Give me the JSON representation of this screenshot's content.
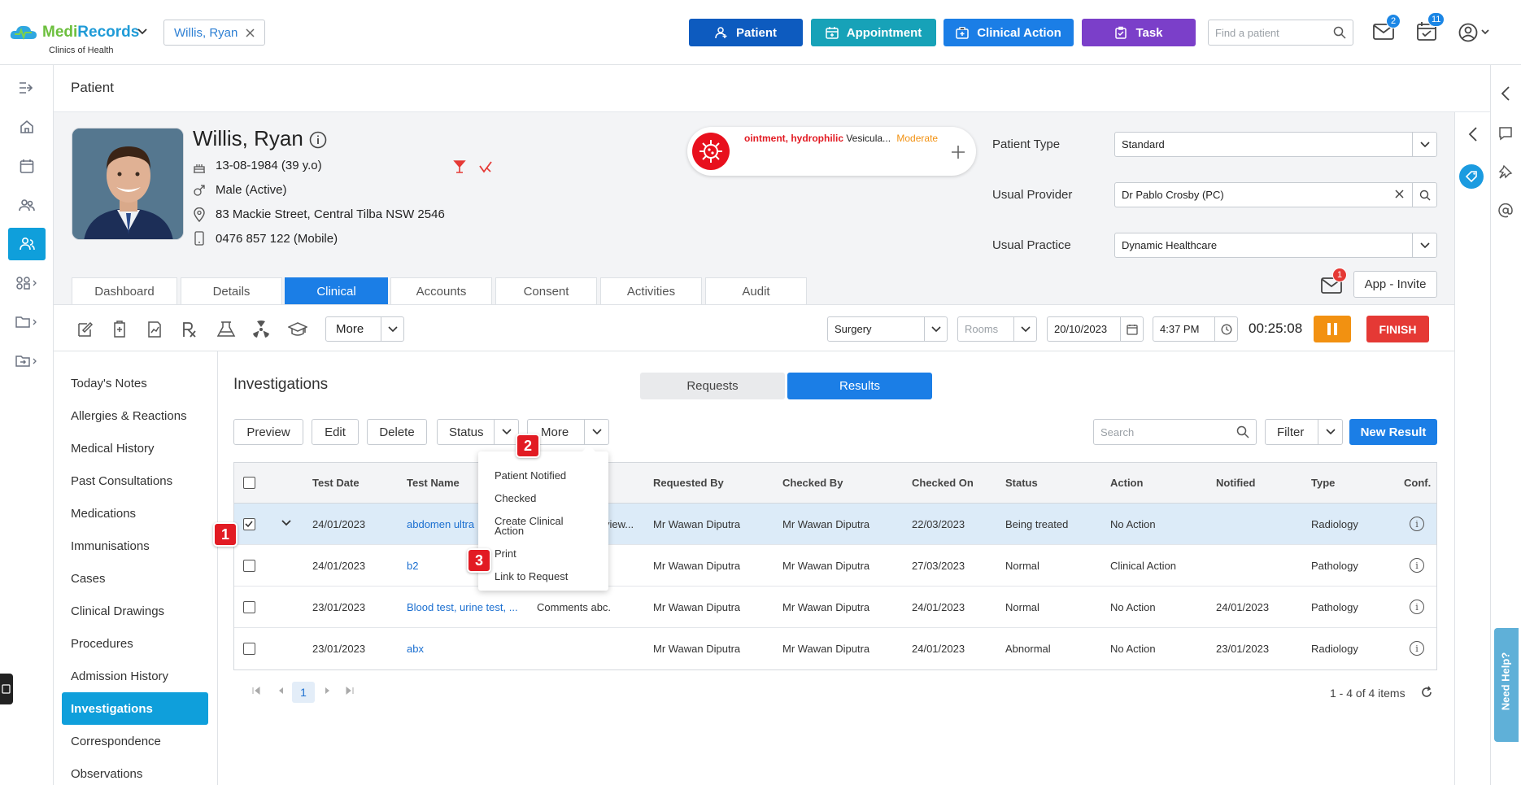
{
  "app": {
    "brand_a": "Medi",
    "brand_b": "Records",
    "subtitle": "Clinics of Health",
    "patient_chip": "Willis, Ryan"
  },
  "topbar": {
    "patient_btn": "Patient",
    "appointment_btn": "Appointment",
    "clinical_action_btn": "Clinical Action",
    "task_btn": "Task",
    "find_placeholder": "Find a patient",
    "mail_count": "2",
    "tasks_count": "11"
  },
  "page": {
    "title": "Patient"
  },
  "patient": {
    "name": "Willis, Ryan",
    "dob": "13-08-1984 (39 y.o)",
    "gender": "Male (Active)",
    "address": "83 Mackie Street, Central Tilba NSW 2546",
    "phone": "0476 857 122 (Mobile)"
  },
  "allergy": {
    "substance": "ointment, hydrophilic",
    "reaction": "Vesicula...",
    "severity": "Moderate"
  },
  "fields": {
    "patient_type_label": "Patient Type",
    "patient_type": "Standard",
    "usual_provider_label": "Usual Provider",
    "usual_provider": "Dr Pablo Crosby (PC)",
    "usual_practice_label": "Usual Practice",
    "usual_practice": "Dynamic Healthcare"
  },
  "tabs": [
    "Dashboard",
    "Details",
    "Clinical",
    "Accounts",
    "Consent",
    "Activities",
    "Audit"
  ],
  "app_invite": {
    "label": "App - Invite",
    "count": "1"
  },
  "toolbar": {
    "more": "More",
    "surgery": "Surgery",
    "rooms": "Rooms",
    "date": "20/10/2023",
    "time": "4:37 PM",
    "timer": "00:25:08",
    "finish": "FINISH"
  },
  "clinical_nav": [
    "Today's Notes",
    "Allergies & Reactions",
    "Medical History",
    "Past Consultations",
    "Medications",
    "Immunisations",
    "Cases",
    "Clinical Drawings",
    "Procedures",
    "Admission History",
    "Investigations",
    "Correspondence",
    "Observations"
  ],
  "investigations": {
    "title": "Investigations",
    "requests": "Requests",
    "results": "Results",
    "preview": "Preview",
    "edit": "Edit",
    "delete": "Delete",
    "status": "Status",
    "more": "More",
    "search_placeholder": "Search",
    "filter": "Filter",
    "new_result": "New Result"
  },
  "grid": {
    "headers": [
      "Test Date",
      "Test Name",
      "Requested By",
      "Checked By",
      "Checked On",
      "Status",
      "Action",
      "Notified",
      "Type",
      "Conf."
    ],
    "rows": [
      {
        "date": "24/01/2023",
        "name": "abdomen ultra",
        "comment": "view...",
        "requested": "Mr Wawan Diputra",
        "checked": "Mr Wawan Diputra",
        "checked_on": "22/03/2023",
        "status": "Being treated",
        "action": "No Action",
        "notified": "",
        "type": "Radiology"
      },
      {
        "date": "24/01/2023",
        "name": "b2",
        "comment": "",
        "requested": "Mr Wawan Diputra",
        "checked": "Mr Wawan Diputra",
        "checked_on": "27/03/2023",
        "status": "Normal",
        "action": "Clinical Action",
        "notified": "",
        "type": "Pathology"
      },
      {
        "date": "23/01/2023",
        "name": "Blood test, urine test, ...",
        "comment": "Comments abc.",
        "requested": "Mr Wawan Diputra",
        "checked": "Mr Wawan Diputra",
        "checked_on": "24/01/2023",
        "status": "Normal",
        "action": "No Action",
        "notified": "24/01/2023",
        "type": "Pathology"
      },
      {
        "date": "23/01/2023",
        "name": "abx",
        "comment": "",
        "requested": "Mr Wawan Diputra",
        "checked": "Mr Wawan Diputra",
        "checked_on": "24/01/2023",
        "status": "Abnormal",
        "action": "No Action",
        "notified": "23/01/2023",
        "type": "Radiology"
      }
    ]
  },
  "menu": {
    "patient_notified": "Patient Notified",
    "checked": "Checked",
    "create_1": "Create Clinical",
    "create_2": "Action",
    "print": "Print",
    "link": "Link to Request"
  },
  "steps": [
    "1",
    "2",
    "3"
  ],
  "pager": {
    "page": "1",
    "summary": "1 - 4 of 4 items"
  },
  "help": "Need Help?",
  "colors": {
    "primary": "#1b7ee6",
    "teal": "#17a2b8",
    "purple": "#7b3fc9",
    "navy": "#0d5bbf",
    "orange": "#f29111",
    "red": "#e53935"
  }
}
